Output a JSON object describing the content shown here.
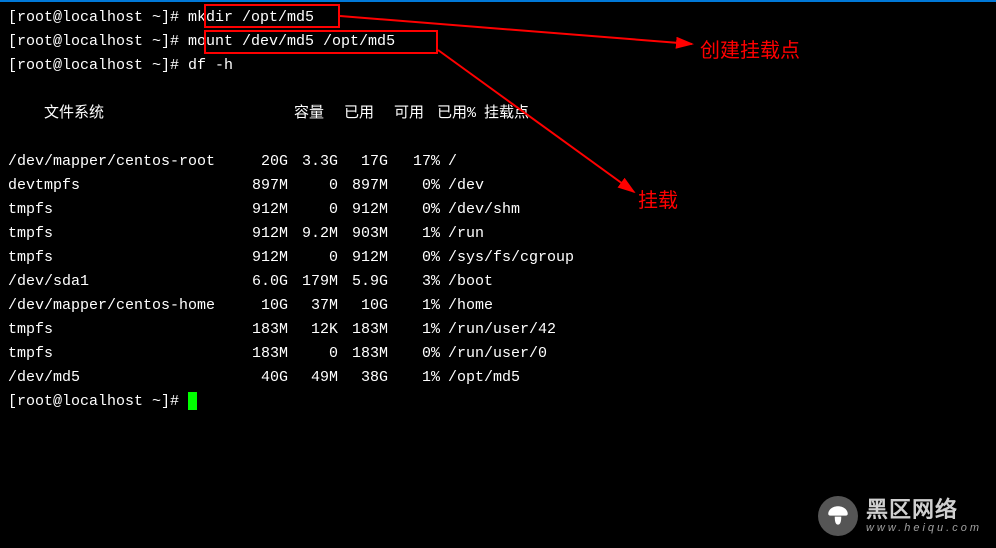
{
  "prompt": "[root@localhost ~]# ",
  "cmd1": "mkdir /opt/md5",
  "cmd2": "mount /dev/md5 /opt/md5",
  "cmd3": "df -h",
  "header": {
    "fs": "文件系统",
    "size": "容量",
    "used": "已用",
    "avail": "可用",
    "pct": "已用%",
    "mount": "挂载点"
  },
  "rows": [
    {
      "fs": "/dev/mapper/centos-root",
      "size": "20G",
      "used": "3.3G",
      "avail": "17G",
      "pct": "17%",
      "mount": "/"
    },
    {
      "fs": "devtmpfs",
      "size": "897M",
      "used": "0",
      "avail": "897M",
      "pct": "0%",
      "mount": "/dev"
    },
    {
      "fs": "tmpfs",
      "size": "912M",
      "used": "0",
      "avail": "912M",
      "pct": "0%",
      "mount": "/dev/shm"
    },
    {
      "fs": "tmpfs",
      "size": "912M",
      "used": "9.2M",
      "avail": "903M",
      "pct": "1%",
      "mount": "/run"
    },
    {
      "fs": "tmpfs",
      "size": "912M",
      "used": "0",
      "avail": "912M",
      "pct": "0%",
      "mount": "/sys/fs/cgroup"
    },
    {
      "fs": "/dev/sda1",
      "size": "6.0G",
      "used": "179M",
      "avail": "5.9G",
      "pct": "3%",
      "mount": "/boot"
    },
    {
      "fs": "/dev/mapper/centos-home",
      "size": "10G",
      "used": "37M",
      "avail": "10G",
      "pct": "1%",
      "mount": "/home"
    },
    {
      "fs": "tmpfs",
      "size": "183M",
      "used": "12K",
      "avail": "183M",
      "pct": "1%",
      "mount": "/run/user/42"
    },
    {
      "fs": "tmpfs",
      "size": "183M",
      "used": "0",
      "avail": "183M",
      "pct": "0%",
      "mount": "/run/user/0"
    },
    {
      "fs": "/dev/md5",
      "size": "40G",
      "used": "49M",
      "avail": "38G",
      "pct": "1%",
      "mount": "/opt/md5"
    }
  ],
  "annotation1": "创建挂载点",
  "annotation2": "挂载",
  "watermark": {
    "title": "黑区网络",
    "url": "www.heiqu.com"
  }
}
